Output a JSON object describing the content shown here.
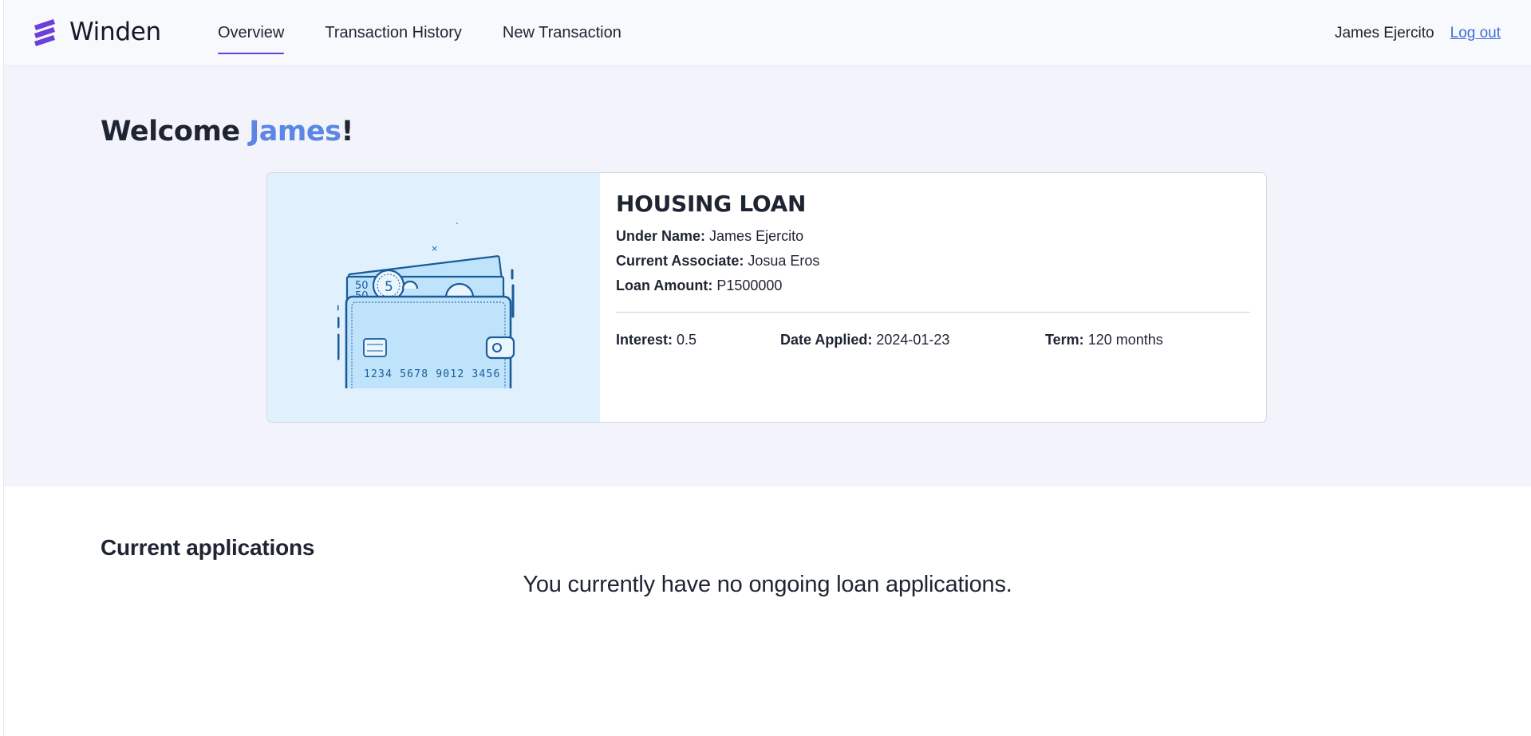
{
  "brand": {
    "name": "Winden",
    "color": "#6b3fd9"
  },
  "nav": {
    "items": [
      {
        "label": "Overview",
        "active": true
      },
      {
        "label": "Transaction History",
        "active": false
      },
      {
        "label": "New Transaction",
        "active": false
      }
    ]
  },
  "user": {
    "name": "James Ejercito",
    "logout_label": "Log out"
  },
  "welcome": {
    "prefix": "Welcome ",
    "name": "James",
    "suffix": "!"
  },
  "loan": {
    "title": "HOUSING LOAN",
    "under_name_label": "Under Name:",
    "under_name": "James Ejercito",
    "associate_label": "Current Associate:",
    "associate": "Josua Eros",
    "amount_label": "Loan Amount:",
    "amount": "P1500000",
    "interest_label": "Interest:",
    "interest": "0.5",
    "date_label": "Date Applied:",
    "date": "2024-01-23",
    "term_label": "Term:",
    "term": "120 months",
    "illustration": {
      "icon": "wallet-icon",
      "card_number": "1234 5678 9012 3456",
      "coin_value": "5",
      "bill_value": "50"
    }
  },
  "applications": {
    "title": "Current applications",
    "empty_message": "You currently have no ongoing loan applications."
  },
  "colors": {
    "accent": "#6b3fd9",
    "highlight": "#5b86e5",
    "link": "#3f6fd6",
    "hero_bg": "#f2f3fb",
    "illustration_bg": "#e0f1fd"
  }
}
